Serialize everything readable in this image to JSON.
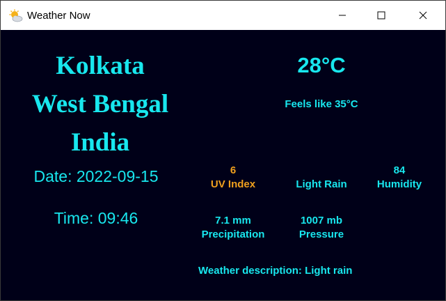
{
  "window": {
    "title": "Weather Now",
    "icon": "weather-sun-cloud-icon"
  },
  "location": {
    "city": "Kolkata",
    "state": "West Bengal",
    "country": "India"
  },
  "date": "Date: 2022-09-15",
  "time": "Time: 09:46",
  "temperature": "28°C",
  "feels_like": "Feels like 35°C",
  "stats": {
    "uv": {
      "value": "6",
      "label": "UV Index"
    },
    "condition": {
      "label": "Light Rain"
    },
    "humidity": {
      "value": "84",
      "label": "Humidity"
    },
    "precipitation": {
      "value": "7.1 mm",
      "label": "Precipitation"
    },
    "pressure": {
      "value": "1007 mb",
      "label": "Pressure"
    }
  },
  "description": "Weather description: Light rain",
  "colors": {
    "background": "#000018",
    "accent": "#18e7ee",
    "uv": "#f0a01e",
    "titlebar": "#ffffff"
  }
}
